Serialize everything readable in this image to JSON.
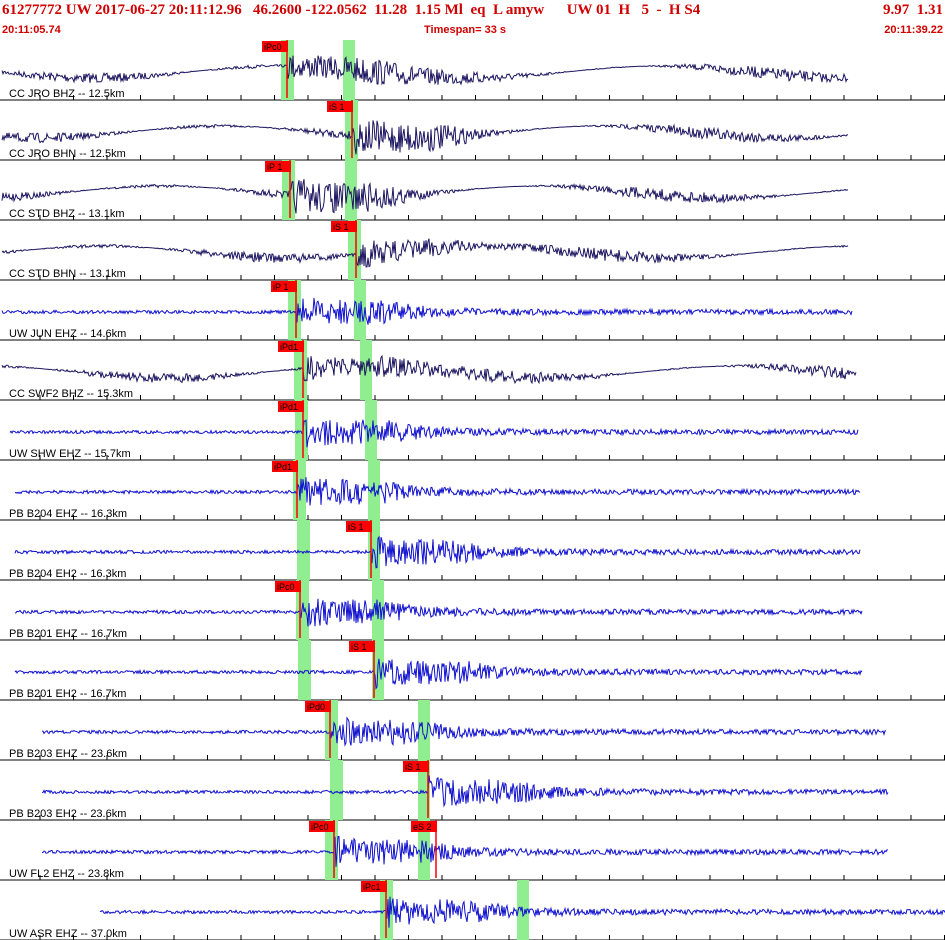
{
  "header": {
    "event_line": "61277772 UW 2017-06-27 20:11:12.96   46.2600 -122.0562  11.28  1.15 Ml  eq  L amyw      UW 01  H   5  -  H S4",
    "event_line_right": "9.97  1.31",
    "start_time": "20:11:05.74",
    "end_time": "20:11:39.22",
    "timespan": "Timespan=  33 s"
  },
  "colors": {
    "title": "#d00000",
    "trace_dark": "#1c1560",
    "trace_blue": "#1010d0",
    "pick": "#ff0000",
    "pick_band": "#90ee90",
    "gridline": "#000000"
  },
  "channels": [
    {
      "label": "CC JRO BHZ -- 12.5km",
      "color": "dark",
      "picks": [
        {
          "tag": "iPc0",
          "kind": "P"
        }
      ]
    },
    {
      "label": "CC JRO BHN -- 12.5km",
      "color": "dark",
      "picks": [
        {
          "tag": "iS 1",
          "kind": "S"
        }
      ]
    },
    {
      "label": "CC STD BHZ -- 13.1km",
      "color": "dark",
      "picks": [
        {
          "tag": "iP 1",
          "kind": "P"
        }
      ]
    },
    {
      "label": "CC STD BHN -- 13.1km",
      "color": "dark",
      "picks": [
        {
          "tag": "iS 1",
          "kind": "S"
        }
      ]
    },
    {
      "label": "UW JUN EHZ -- 14.6km",
      "color": "blue",
      "picks": [
        {
          "tag": "iP 1",
          "kind": "P"
        }
      ]
    },
    {
      "label": "CC SWF2 BHZ -- 15.3km",
      "color": "dark",
      "picks": [
        {
          "tag": "iPd1",
          "kind": "P"
        }
      ]
    },
    {
      "label": "UW SHW EHZ -- 15.7km",
      "color": "blue",
      "picks": [
        {
          "tag": "iPd1",
          "kind": "P"
        }
      ]
    },
    {
      "label": "PB B204 EHZ -- 16.3km",
      "color": "blue",
      "picks": [
        {
          "tag": "iPd1",
          "kind": "P"
        }
      ]
    },
    {
      "label": "PB B204 EH2 -- 16.3km",
      "color": "blue",
      "picks": [
        {
          "tag": "iS 1",
          "kind": "S"
        }
      ]
    },
    {
      "label": "PB B201 EHZ -- 16.7km",
      "color": "blue",
      "picks": [
        {
          "tag": "iPc0",
          "kind": "P"
        }
      ]
    },
    {
      "label": "PB B201 EH2 -- 16.7km",
      "color": "blue",
      "picks": [
        {
          "tag": "iS 1",
          "kind": "S"
        }
      ]
    },
    {
      "label": "PB B203 EHZ -- 23.6km",
      "color": "blue",
      "picks": [
        {
          "tag": "iPd0",
          "kind": "P"
        }
      ]
    },
    {
      "label": "PB B203 EH2 -- 23.6km",
      "color": "blue",
      "picks": [
        {
          "tag": "iS 1",
          "kind": "S"
        }
      ]
    },
    {
      "label": "UW FL2 EHZ -- 23.8km",
      "color": "blue",
      "picks": [
        {
          "tag": "iPc0",
          "kind": "P"
        },
        {
          "tag": "eS 2",
          "kind": "S"
        }
      ]
    },
    {
      "label": "UW ASR EHZ -- 37.0km",
      "color": "blue",
      "picks": [
        {
          "tag": "iPc1",
          "kind": "P"
        }
      ]
    }
  ]
}
